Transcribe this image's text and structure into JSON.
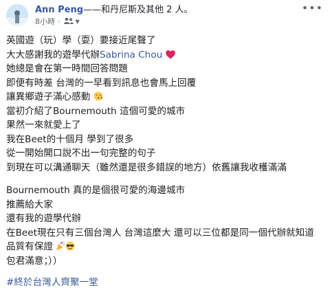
{
  "post": {
    "author": "Ann Peng",
    "with_text": "——和丹尼斯及其他 2 人。",
    "time": "8小時",
    "dot": "·",
    "more": "•••"
  },
  "body": {
    "l1": "英國遊（玩）學（耍）要接近尾聲了",
    "l2_prefix": "大大感謝我的遊學代辦",
    "l2_name": "Sabrina Chou",
    "l3": "她總是會在第一時間回答問題",
    "l4": "即便有時差 台灣的一早看到訊息也會馬上回覆",
    "l5": "讓異鄉遊子滿心感動",
    "l6": "當初介紹了Bournemouth 這個可愛的城市",
    "l7": "果然一來就愛上了",
    "l8": "我在Beet的十個月 學到了很多",
    "l9": "從一開始開口說不出一句完整的句子",
    "l10": "到現在可以溝通聊天（雖然還是很多錯誤的地方）依舊讓我收穫滿滿",
    "l11": "Bournemouth 真的是個很可愛的海邊城市",
    "l12": "推薦給大家",
    "l13": "還有我的遊學代辦",
    "l14": "在Beet現在只有三個台灣人 台灣這麼大 還可以三位都是同一個代辦就知道",
    "l15": "品質有保證",
    "l16": "包君滿意；））",
    "hashtag": "#終於台灣人齊聚一堂"
  },
  "icons": {
    "heart": "red-heart-emoji",
    "kiss": "face-blowing-kiss-emoji",
    "party": "party-popper-emoji",
    "sunglasses": "smiling-face-with-sunglasses-emoji",
    "audience": "friends-audience-icon"
  },
  "colors": {
    "link": "#385898",
    "meta": "#616770",
    "text": "#1c1e21"
  }
}
